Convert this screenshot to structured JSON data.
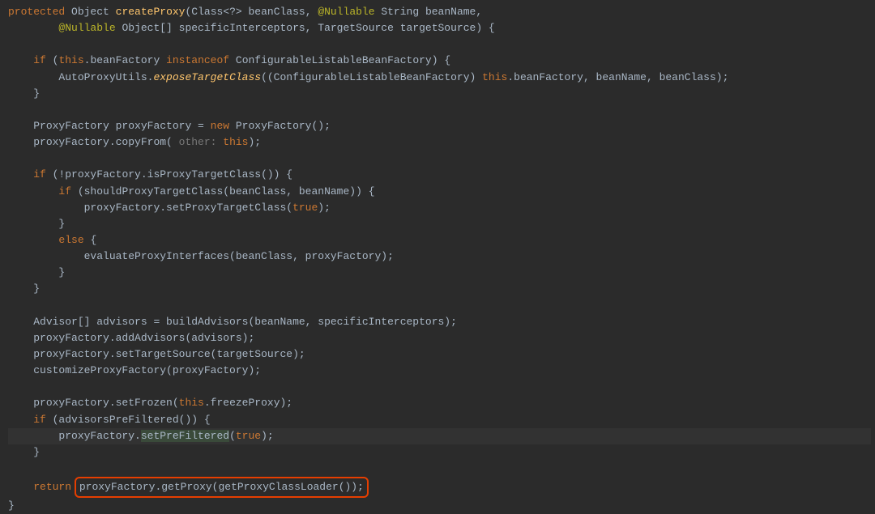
{
  "code": {
    "l1": {
      "protected": "protected",
      "object": "Object",
      "createProxy": "createProxy",
      "classParam": "(Class<?> beanClass, ",
      "nullable1": "@Nullable",
      "stringParam": " String beanName,",
      "nullable2": "@Nullable",
      "objArr": " Object[] specificInterceptors, TargetSource targetSource) {"
    },
    "l3": {
      "if": "if",
      "cond1": " (",
      "this": "this",
      "dotBeanFactory": ".beanFactory ",
      "instanceof": "instanceof",
      "rest": " ConfigurableListableBeanFactory) {"
    },
    "l4": {
      "cls": "AutoProxyUtils.",
      "m": "exposeTargetClass",
      "args1": "((ConfigurableListableBeanFactory) ",
      "this": "this",
      "args2": ".beanFactory, beanName, beanClass);"
    },
    "l5": "}",
    "l7": {
      "pf": "ProxyFactory proxyFactory = ",
      "new": "new",
      "rest": " ProxyFactory();"
    },
    "l8": {
      "txt": "proxyFactory.copyFrom( ",
      "hint": "other:",
      "this": "this",
      "end": ");"
    },
    "l10": {
      "if": "if",
      "rest": " (!proxyFactory.isProxyTargetClass()) {"
    },
    "l11": {
      "if": "if",
      "rest": " (shouldProxyTargetClass(beanClass, beanName)) {"
    },
    "l12": {
      "txt": "proxyFactory.setProxyTargetClass(",
      "true": "true",
      "end": ");"
    },
    "l13": "}",
    "l14": {
      "else": "else",
      "brace": " {"
    },
    "l15": "evaluateProxyInterfaces(beanClass, proxyFactory);",
    "l16": "}",
    "l17": "}",
    "l19": "Advisor[] advisors = buildAdvisors(beanName, specificInterceptors);",
    "l20": "proxyFactory.addAdvisors(advisors);",
    "l21": "proxyFactory.setTargetSource(targetSource);",
    "l22": "customizeProxyFactory(proxyFactory);",
    "l24": {
      "txt": "proxyFactory.setFrozen(",
      "this": "this",
      "rest": ".freezeProxy);"
    },
    "l25": {
      "if": "if",
      "rest": " (advisorsPreFiltered()) {"
    },
    "l26": {
      "txt": "proxyFactory.",
      "m": "setPreFiltered",
      "open": "(",
      "true": "true",
      "end": ");"
    },
    "l27": "}",
    "l29": {
      "return": "return",
      "boxed": "proxyFactory.getProxy(getProxyClassLoader());"
    },
    "l30": "}"
  }
}
